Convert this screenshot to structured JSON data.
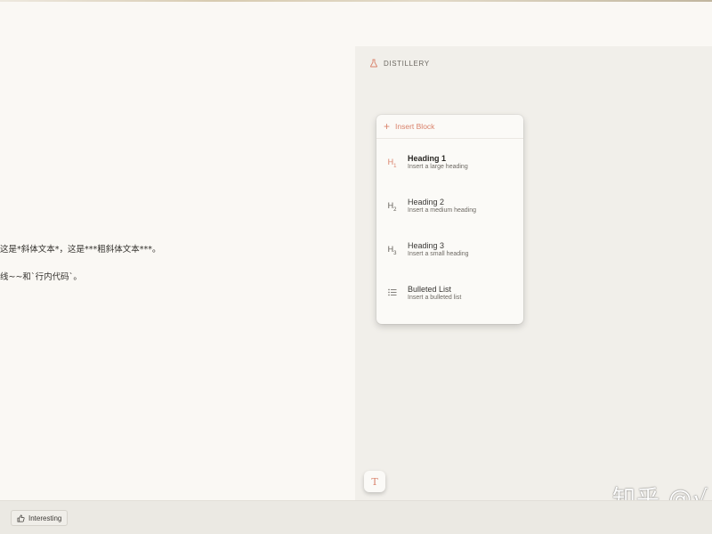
{
  "editor": {
    "line1": "这是*斜体文本*，这是***粗斜体文本***。",
    "line2": "线~~和`行内代码`。"
  },
  "brand": {
    "name": "DISTILLERY",
    "icon": "flask-icon"
  },
  "block_menu": {
    "header": "Insert Block",
    "items": [
      {
        "icon": "H1",
        "title": "Heading 1",
        "description": "Insert a large heading"
      },
      {
        "icon": "H2",
        "title": "Heading 2",
        "description": "Insert a medium heading"
      },
      {
        "icon": "H3",
        "title": "Heading 3",
        "description": "Insert a small heading"
      },
      {
        "icon": "list-icon",
        "title": "Bulleted List",
        "description": "Insert a bulleted list"
      }
    ]
  },
  "fab": {
    "glyph": "T"
  },
  "watermark": "知乎 @√",
  "bottom_bar": {
    "interesting_label": "Interesting"
  },
  "colors": {
    "accent": "#d9826b",
    "background": "#faf8f4",
    "panel": "#f1efea"
  }
}
